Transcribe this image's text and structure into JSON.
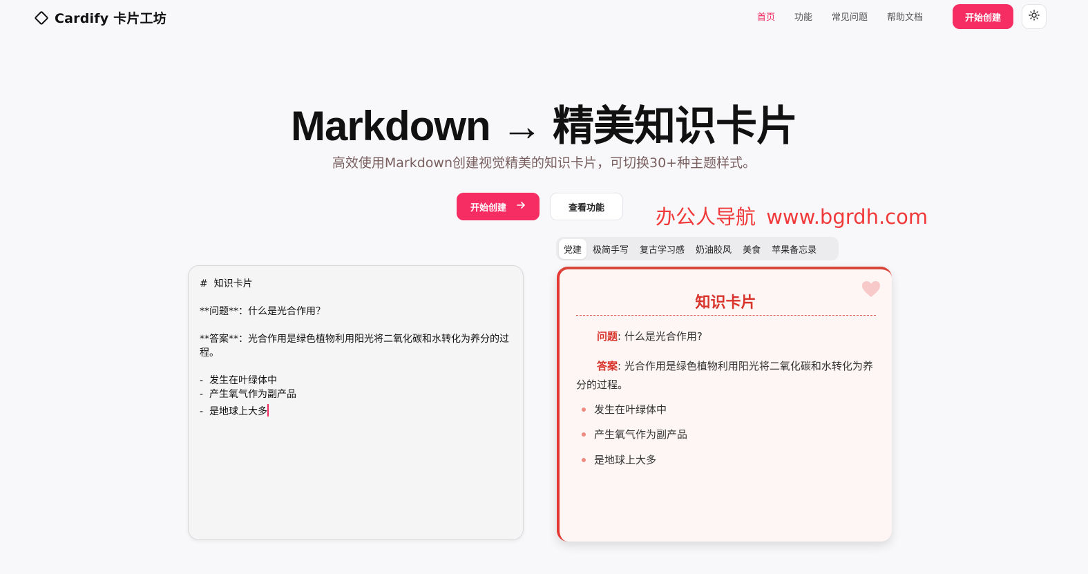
{
  "header": {
    "logo_text": "Cardify 卡片工坊",
    "nav": [
      "首页",
      "功能",
      "常见问题",
      "帮助文档"
    ],
    "cta_label": "开始创建",
    "theme_icon": "sun-icon"
  },
  "hero": {
    "title": "Markdown → 精美知识卡片",
    "subtitle": "高效使用Markdown创建视觉精美的知识卡片，可切换30+种主题样式。",
    "primary_label": "开始创建",
    "secondary_label": "查看功能",
    "watermark": "办公人导航  www.bgrdh.com"
  },
  "themes": {
    "tabs": [
      "党建",
      "极简手写",
      "复古学习感",
      "奶油胶风",
      "美食",
      "苹果备忘录"
    ],
    "active_index": 0
  },
  "editor": {
    "lines": [
      "#  知识卡片",
      "",
      "**问题**：什么是光合作用？",
      "",
      "**答案**：光合作用是绿色植物利用阳光将二氧化碳和水转化为养分的过程。",
      "",
      "-  发生在叶绿体中",
      "-  产生氧气作为副产品",
      "-  是地球上大多"
    ]
  },
  "card": {
    "title": "知识卡片",
    "q_label": "问题",
    "q_text": ": 什么是光合作用?",
    "a_label": "答案",
    "a_text": ": 光合作用是绿色植物利用阳光将二氧化碳和水转化为养分的过程。",
    "bullets": [
      "发生在叶绿体中",
      "产生氧气作为副产品",
      "是地球上大多"
    ]
  },
  "colors": {
    "accent": "#f62d63",
    "card_red": "#d9342b",
    "watermark": "#f03a3a"
  }
}
